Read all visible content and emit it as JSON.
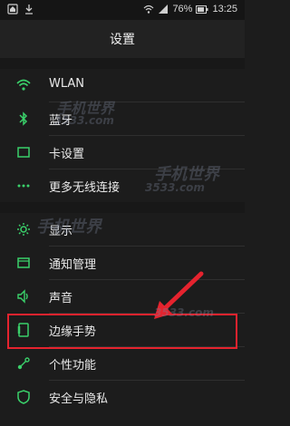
{
  "status_bar": {
    "battery_percent": "76%",
    "time": "13:25"
  },
  "header": {
    "title": "设置"
  },
  "settings": [
    {
      "label": "WLAN",
      "icon": "wifi-icon"
    },
    {
      "label": "蓝牙",
      "icon": "bluetooth-icon"
    },
    {
      "label": "卡设置",
      "icon": "sim-card-icon"
    },
    {
      "label": "更多无线连接",
      "icon": "more-dots-icon"
    },
    {
      "label": "显示",
      "icon": "brightness-icon"
    },
    {
      "label": "通知管理",
      "icon": "notification-icon"
    },
    {
      "label": "声音",
      "icon": "speaker-icon"
    },
    {
      "label": "边缘手势",
      "icon": "edge-gesture-icon"
    },
    {
      "label": "个性功能",
      "icon": "personalize-icon"
    },
    {
      "label": "安全与隐私",
      "icon": "shield-icon"
    }
  ],
  "watermark": {
    "brand": "手机世界",
    "domain": "3533.com"
  },
  "colors": {
    "accent": "#3ad06a",
    "highlight": "#e5232e",
    "background": "#1c1c1c"
  }
}
